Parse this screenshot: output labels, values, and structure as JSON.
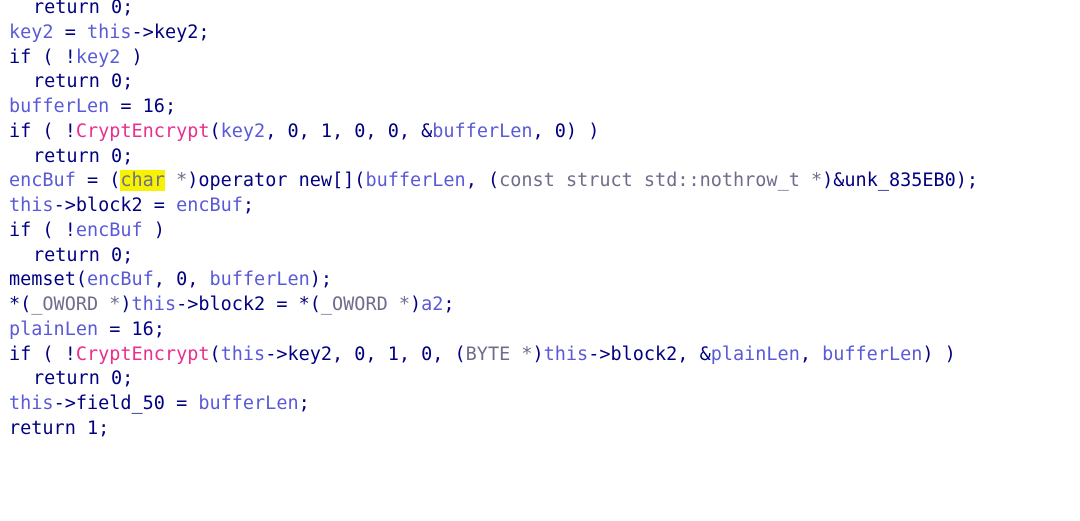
{
  "editor": {
    "colors": {
      "plain": "#000080",
      "variable": "#5a5ad8",
      "function": "#e8308c",
      "type": "#6e6e8c",
      "highlight": "#f7f300",
      "background": "#ffffff"
    },
    "lines": [
      {
        "indent": true,
        "tokens": [
          {
            "t": "return 0;",
            "k": "plain"
          }
        ]
      },
      {
        "indent": false,
        "tokens": [
          {
            "t": "key2",
            "k": "var"
          },
          {
            "t": " = ",
            "k": "plain"
          },
          {
            "t": "this",
            "k": "var"
          },
          {
            "t": "->key2;",
            "k": "plain"
          }
        ]
      },
      {
        "indent": false,
        "tokens": [
          {
            "t": "if ( !",
            "k": "plain"
          },
          {
            "t": "key2",
            "k": "var"
          },
          {
            "t": " )",
            "k": "plain"
          }
        ]
      },
      {
        "indent": true,
        "tokens": [
          {
            "t": "return 0;",
            "k": "plain"
          }
        ]
      },
      {
        "indent": false,
        "tokens": [
          {
            "t": "bufferLen",
            "k": "var"
          },
          {
            "t": " = 16;",
            "k": "plain"
          }
        ]
      },
      {
        "indent": false,
        "tokens": [
          {
            "t": "if ( !",
            "k": "plain"
          },
          {
            "t": "CryptEncrypt",
            "k": "func"
          },
          {
            "t": "(",
            "k": "plain"
          },
          {
            "t": "key2",
            "k": "var"
          },
          {
            "t": ", 0, 1, 0, 0, &",
            "k": "plain"
          },
          {
            "t": "bufferLen",
            "k": "var"
          },
          {
            "t": ", 0) )",
            "k": "plain"
          }
        ]
      },
      {
        "indent": true,
        "tokens": [
          {
            "t": "return 0;",
            "k": "plain"
          }
        ]
      },
      {
        "indent": false,
        "tokens": [
          {
            "t": "encBuf",
            "k": "var"
          },
          {
            "t": " = (",
            "k": "plain"
          },
          {
            "t": "char",
            "k": "type-hl"
          },
          {
            "t": " *",
            "k": "type"
          },
          {
            "t": ")operator new[](",
            "k": "plain"
          },
          {
            "t": "bufferLen",
            "k": "var"
          },
          {
            "t": ", (",
            "k": "plain"
          },
          {
            "t": "const struct std::nothrow_t *",
            "k": "type"
          },
          {
            "t": ")&unk_835EB0);",
            "k": "plain"
          }
        ]
      },
      {
        "indent": false,
        "tokens": [
          {
            "t": "this",
            "k": "var"
          },
          {
            "t": "->block2 = ",
            "k": "plain"
          },
          {
            "t": "encBuf",
            "k": "var"
          },
          {
            "t": ";",
            "k": "plain"
          }
        ]
      },
      {
        "indent": false,
        "tokens": [
          {
            "t": "if ( !",
            "k": "plain"
          },
          {
            "t": "encBuf",
            "k": "var"
          },
          {
            "t": " )",
            "k": "plain"
          }
        ]
      },
      {
        "indent": true,
        "tokens": [
          {
            "t": "return 0;",
            "k": "plain"
          }
        ]
      },
      {
        "indent": false,
        "tokens": [
          {
            "t": "memset(",
            "k": "plain"
          },
          {
            "t": "encBuf",
            "k": "var"
          },
          {
            "t": ", 0, ",
            "k": "plain"
          },
          {
            "t": "bufferLen",
            "k": "var"
          },
          {
            "t": ");",
            "k": "plain"
          }
        ]
      },
      {
        "indent": false,
        "tokens": [
          {
            "t": "*(",
            "k": "plain"
          },
          {
            "t": "_OWORD *",
            "k": "type"
          },
          {
            "t": ")",
            "k": "plain"
          },
          {
            "t": "this",
            "k": "var"
          },
          {
            "t": "->block2 = *(",
            "k": "plain"
          },
          {
            "t": "_OWORD *",
            "k": "type"
          },
          {
            "t": ")",
            "k": "plain"
          },
          {
            "t": "a2",
            "k": "var"
          },
          {
            "t": ";",
            "k": "plain"
          }
        ]
      },
      {
        "indent": false,
        "tokens": [
          {
            "t": "plainLen",
            "k": "var"
          },
          {
            "t": " = 16;",
            "k": "plain"
          }
        ]
      },
      {
        "indent": false,
        "tokens": [
          {
            "t": "if ( !",
            "k": "plain"
          },
          {
            "t": "CryptEncrypt",
            "k": "func"
          },
          {
            "t": "(",
            "k": "plain"
          },
          {
            "t": "this",
            "k": "var"
          },
          {
            "t": "->key2, 0, 1, 0, (",
            "k": "plain"
          },
          {
            "t": "BYTE *",
            "k": "type"
          },
          {
            "t": ")",
            "k": "plain"
          },
          {
            "t": "this",
            "k": "var"
          },
          {
            "t": "->block2, &",
            "k": "plain"
          },
          {
            "t": "plainLen",
            "k": "var"
          },
          {
            "t": ", ",
            "k": "plain"
          },
          {
            "t": "bufferLen",
            "k": "var"
          },
          {
            "t": ") )",
            "k": "plain"
          }
        ]
      },
      {
        "indent": true,
        "tokens": [
          {
            "t": "return 0;",
            "k": "plain"
          }
        ]
      },
      {
        "indent": false,
        "tokens": [
          {
            "t": "this",
            "k": "var"
          },
          {
            "t": "->field_50 = ",
            "k": "plain"
          },
          {
            "t": "bufferLen",
            "k": "var"
          },
          {
            "t": ";",
            "k": "plain"
          }
        ]
      },
      {
        "indent": false,
        "tokens": [
          {
            "t": "return 1;",
            "k": "plain"
          }
        ]
      }
    ]
  }
}
